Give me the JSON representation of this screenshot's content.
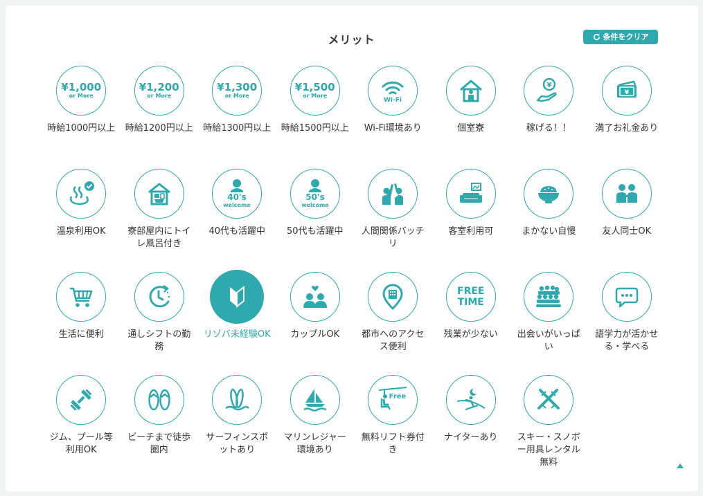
{
  "header": {
    "title": "メリット",
    "clear_label": "条件をクリア"
  },
  "colors": {
    "accent": "#2ea9ad",
    "background": "#eef3f3",
    "panel": "#ffffff"
  },
  "items": [
    {
      "label": "時給1000円以上",
      "icon": "wage-1000-icon",
      "amount": "¥1,000",
      "sub": "or More"
    },
    {
      "label": "時給1200円以上",
      "icon": "wage-1200-icon",
      "amount": "¥1,200",
      "sub": "or More"
    },
    {
      "label": "時給1300円以上",
      "icon": "wage-1300-icon",
      "amount": "¥1,300",
      "sub": "or More"
    },
    {
      "label": "時給1500円以上",
      "icon": "wage-1500-icon",
      "amount": "¥1,500",
      "sub": "or More"
    },
    {
      "label": "Wi-Fi環境あり",
      "icon": "wifi-icon",
      "sub": "Wi-Fi"
    },
    {
      "label": "個室寮",
      "icon": "house-person-icon"
    },
    {
      "label": "稼げる！！",
      "icon": "hand-yen-coin-icon"
    },
    {
      "label": "満了お礼金あり",
      "icon": "money-envelope-icon"
    },
    {
      "label": "温泉利用OK",
      "icon": "hot-spring-check-icon"
    },
    {
      "label": "寮部屋内にトイレ風呂付き",
      "icon": "room-toilet-bath-icon"
    },
    {
      "label": "40代も活躍中",
      "icon": "person-40s-icon",
      "num": "40's",
      "sub": "welcome"
    },
    {
      "label": "50代も活躍中",
      "icon": "person-50s-icon",
      "num": "50's",
      "sub": "welcome"
    },
    {
      "label": "人間関係バッチリ",
      "icon": "high-five-icon"
    },
    {
      "label": "客室利用可",
      "icon": "sofa-picture-icon"
    },
    {
      "label": "まかない自慢",
      "icon": "rice-bowl-icon"
    },
    {
      "label": "友人同士OK",
      "icon": "friends-icon"
    },
    {
      "label": "生活に便利",
      "icon": "shopping-cart-icon"
    },
    {
      "label": "通しシフトの勤務",
      "icon": "clock-shift-icon"
    },
    {
      "label": "リゾバ未経験OK",
      "icon": "beginner-mark-icon",
      "selected": true
    },
    {
      "label": "カップルOK",
      "icon": "couple-heart-icon"
    },
    {
      "label": "都市へのアクセス便利",
      "icon": "map-pin-building-icon"
    },
    {
      "label": "残業が少ない",
      "icon": "free-time-icon",
      "line1": "FREE",
      "line2": "TIME"
    },
    {
      "label": "出会いがいっぱい",
      "icon": "crowd-icon"
    },
    {
      "label": "語学力が活かせる・学べる",
      "icon": "speech-bubble-icon"
    },
    {
      "label": "ジム、プール等利用OK",
      "icon": "dumbbell-icon"
    },
    {
      "label": "ビーチまで徒歩圏内",
      "icon": "sandals-icon"
    },
    {
      "label": "サーフィンスポットあり",
      "icon": "surfboards-icon"
    },
    {
      "label": "マリンレジャー環境あり",
      "icon": "sailboat-icon"
    },
    {
      "label": "無料リフト券付き",
      "icon": "ski-lift-free-icon",
      "sub": "Free"
    },
    {
      "label": "ナイターあり",
      "icon": "night-skier-icon"
    },
    {
      "label": "スキー・スノボー用具レンタル無料",
      "icon": "skis-icon"
    }
  ]
}
